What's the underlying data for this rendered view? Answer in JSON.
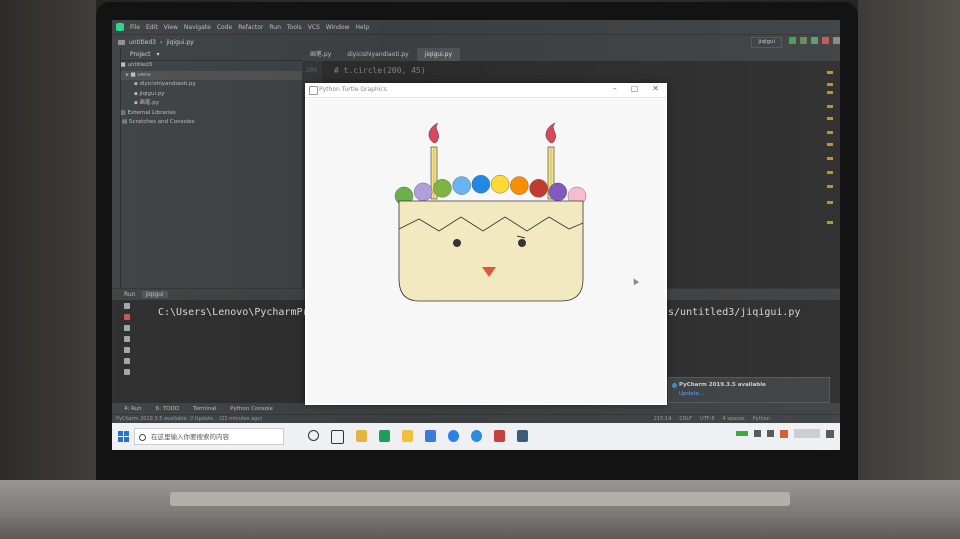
{
  "ide": {
    "menu_items": [
      "File",
      "Edit",
      "View",
      "Navigate",
      "Code",
      "Refactor",
      "Run",
      "Tools",
      "VCS",
      "Window",
      "Help"
    ],
    "navbar_project": "untitled3",
    "navbar_file": "jiqigui.py",
    "project_label": "Project",
    "tree": [
      {
        "label": "untitled3"
      },
      {
        "label": "venv"
      },
      {
        "label": "diyicishiyandiaoti.py"
      },
      {
        "label": "jiqigui.py"
      },
      {
        "label": "画笔.py"
      },
      {
        "label": "External Libraries"
      },
      {
        "label": "Scratches and Consoles"
      }
    ],
    "tabs": [
      "画笔.py",
      "diyicishiyandiaoti.py",
      "jiqigui.py"
    ],
    "code_line_no": "209",
    "code_line": "# t.circle(200, 45)",
    "run_config": "jiqigui",
    "run_label": "Run",
    "run_tab": "jiqigui",
    "console_left": "C:\\Users\\Lenovo\\PycharmProj",
    "console_right": "ts/untitled3/jiqigui.py",
    "notification_title": "PyCharm 2019.3.5 available",
    "notification_link": "Update...",
    "bottom_tools": [
      "4: Run",
      "6: TODO",
      "Terminal",
      "Python Console"
    ],
    "status_left": "PyCharm 2019.3.5 available: // Update... (21 minutes ago)",
    "status_right": [
      "215:14",
      "CRLF",
      "UTF-8",
      "4 spaces",
      "Python"
    ]
  },
  "taskbar": {
    "search_placeholder": "在这里输入你要搜索的内容"
  },
  "turtle_window": {
    "title": "Python Turtle Graphics"
  },
  "colors": {
    "cake_body": "#f2e9c0",
    "candle_flame": "#d9485a",
    "beak": "#e0573a",
    "balls": [
      "#6ab04c",
      "#b39ddb",
      "#7cb342",
      "#64b5f6",
      "#1e88e5",
      "#fdd835",
      "#fb8c00",
      "#c0392b",
      "#7e57c2",
      "#f8bbd0"
    ]
  }
}
